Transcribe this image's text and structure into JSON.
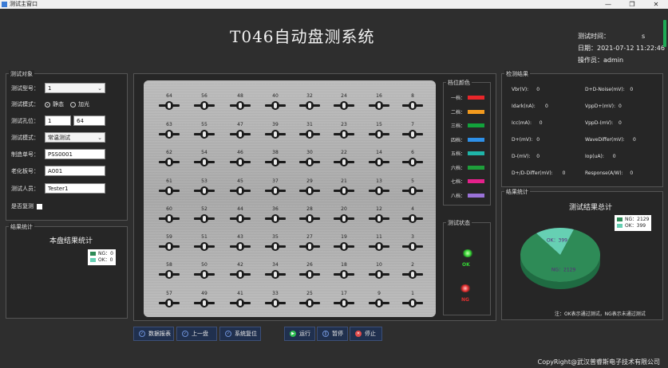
{
  "window": {
    "title": "测试主窗口",
    "buttons": [
      "—",
      "❐",
      "✕"
    ]
  },
  "header": {
    "title": "T046自动盘测系统",
    "test_time_label": "测试时间：",
    "test_time_value": "s",
    "date_label": "日期：",
    "date_value": "2021-07-12 11:22:46",
    "operator_label": "操作员：",
    "operator_value": "admin"
  },
  "test_object": {
    "title": "测试对象",
    "model_label": "测试型号：",
    "model_value": "1",
    "mode_label": "测试模式：",
    "mode_options": [
      "静态",
      "加光"
    ],
    "mode_selected": 0,
    "hole_label": "测试孔位：",
    "hole_from": "1",
    "hole_to": "64",
    "test_mode2_label": "测试模式：",
    "test_mode2_value": "常温测试",
    "order_label": "制造单号：",
    "order_value": "PSS0001",
    "board_label": "老化板号：",
    "board_value": "A001",
    "tester_label": "测试人员：",
    "tester_value": "Tester1",
    "retest_label": "是否复测"
  },
  "plate_stats": {
    "title": "结果统计",
    "heading": "本盘结果统计",
    "ng_label": "NG：0",
    "ok_label": "OK：0"
  },
  "plate": {
    "rows": [
      [
        64,
        56,
        48,
        40,
        32,
        24,
        16,
        8
      ],
      [
        63,
        55,
        47,
        39,
        31,
        23,
        15,
        7
      ],
      [
        62,
        54,
        46,
        38,
        30,
        22,
        14,
        6
      ],
      [
        61,
        53,
        45,
        37,
        29,
        21,
        13,
        5
      ],
      [
        60,
        52,
        44,
        36,
        28,
        20,
        12,
        4
      ],
      [
        59,
        51,
        43,
        35,
        27,
        19,
        11,
        3
      ],
      [
        58,
        50,
        42,
        34,
        26,
        18,
        10,
        2
      ],
      [
        57,
        49,
        41,
        33,
        25,
        17,
        9,
        1
      ]
    ]
  },
  "grades": {
    "title": "档位颜色",
    "items": [
      {
        "label": "一档：",
        "color": "#e8262a"
      },
      {
        "label": "二档：",
        "color": "#f39a1e"
      },
      {
        "label": "三档：",
        "color": "#12a23b"
      },
      {
        "label": "四档：",
        "color": "#2e90e8"
      },
      {
        "label": "五档：",
        "color": "#1fb5a8"
      },
      {
        "label": "六档：",
        "color": "#1e9e3a"
      },
      {
        "label": "七档：",
        "color": "#e4218b"
      },
      {
        "label": "八档：",
        "color": "#9a72d8"
      }
    ]
  },
  "test_status": {
    "title": "测试状态",
    "ok": "OK",
    "ng": "NG"
  },
  "detect_results": {
    "title": "检测结果",
    "items": [
      {
        "label": "Vbr(V):",
        "value": "0"
      },
      {
        "label": "D+D-Noise(mV):",
        "value": "0"
      },
      {
        "label": "Idark(nA):",
        "value": "0"
      },
      {
        "label": "VppD+(mV):",
        "value": "0"
      },
      {
        "label": "Icc(mA):",
        "value": "0"
      },
      {
        "label": "VppD-(mV):",
        "value": "0"
      },
      {
        "label": "D+(mV):",
        "value": "0"
      },
      {
        "label": "WaveDiffer(mV):",
        "value": "0"
      },
      {
        "label": "D-(mV):",
        "value": "0"
      },
      {
        "label": "Iop(uA):",
        "value": "0"
      },
      {
        "label": "D+/D-Differ(mV):",
        "value": "0"
      },
      {
        "label": "Response(A/W):",
        "value": "0"
      }
    ]
  },
  "total_stats": {
    "title": "结果统计",
    "heading": "测试结果总计",
    "ng_label": "NG：2129",
    "ok_label": "OK：399",
    "ng_slice": "NG：2129",
    "ok_slice": "OK：399",
    "note": "注：OK表示通过测试，NG表示未通过测试"
  },
  "chart_data": {
    "type": "pie",
    "title": "测试结果总计",
    "labels": [
      "NG",
      "OK"
    ],
    "values": [
      2129,
      399
    ],
    "colors": [
      "#2e8b57",
      "#66d0b3"
    ]
  },
  "buttons": {
    "report": "数据报表",
    "prev": "上一盘",
    "reset": "系统复位",
    "run": "运行",
    "pause": "暂停",
    "stop": "停止"
  },
  "footer": {
    "copyright": "CopyRight@武汉普睿斯电子技术有限公司"
  }
}
